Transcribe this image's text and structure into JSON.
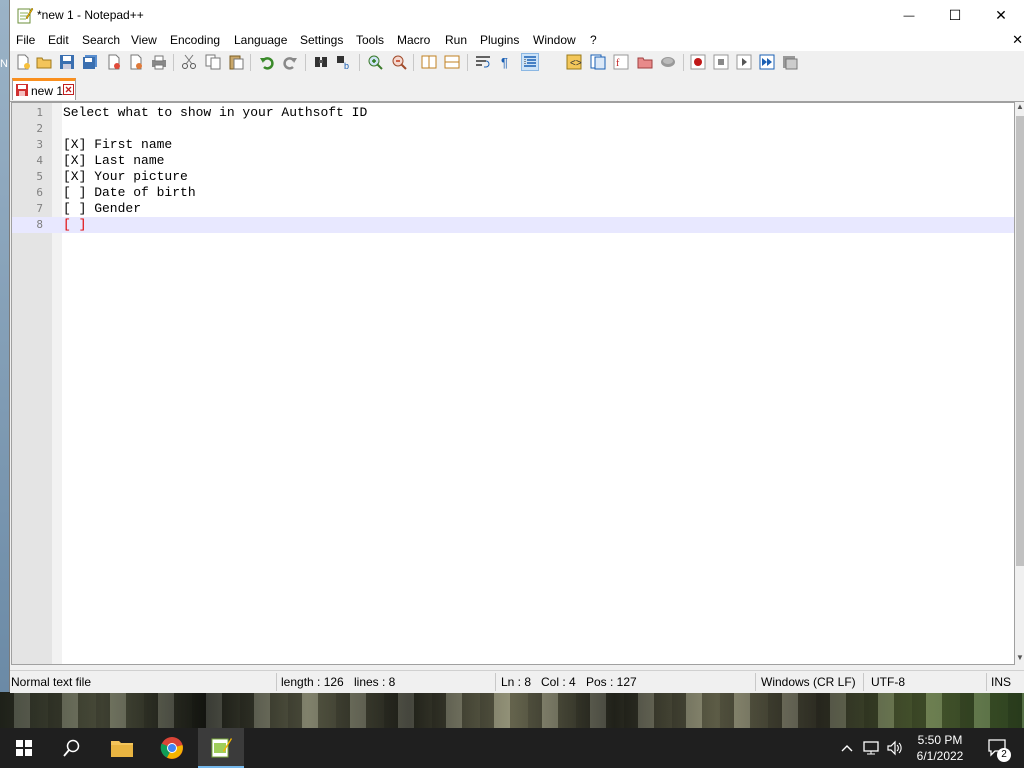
{
  "window": {
    "title": "*new 1 - Notepad++",
    "minimize_glyph": "—",
    "maximize_glyph": "☐",
    "close_glyph": "✕"
  },
  "menu": {
    "items": [
      "File",
      "Edit",
      "Search",
      "View",
      "Encoding",
      "Language",
      "Settings",
      "Tools",
      "Macro",
      "Run",
      "Plugins",
      "Window",
      "?"
    ],
    "close_glyph": "✕"
  },
  "toolbar": {
    "icons": [
      "new-file-icon",
      "open-file-icon",
      "save-icon",
      "save-all-icon",
      "close-icon",
      "close-all-icon",
      "print-icon",
      "cut-icon",
      "copy-icon",
      "paste-icon",
      "undo-icon",
      "redo-icon",
      "find-icon",
      "replace-icon",
      "zoom-in-icon",
      "zoom-out-icon",
      "sync-vertical-icon",
      "sync-horizontal-icon",
      "word-wrap-icon",
      "show-all-chars-icon",
      "indent-guide-icon",
      "udl-icon",
      "doc-map-icon",
      "function-list-icon",
      "folder-workspace-icon",
      "monitoring-icon",
      "record-macro-icon",
      "stop-record-icon",
      "play-macro-icon",
      "run-macro-multiple-icon",
      "save-macro-icon"
    ]
  },
  "tabs": [
    {
      "label": "new 1",
      "modified": true,
      "active": true
    }
  ],
  "editor": {
    "lines": [
      {
        "num": "1",
        "text": "Select what to show in your Authsoft ID"
      },
      {
        "num": "2",
        "text": ""
      },
      {
        "num": "3",
        "text": "[X] First name"
      },
      {
        "num": "4",
        "text": "[X] Last name"
      },
      {
        "num": "5",
        "text": "[X] Your picture"
      },
      {
        "num": "6",
        "text": "[ ] Date of birth"
      },
      {
        "num": "7",
        "text": "[ ] Gender"
      },
      {
        "num": "8",
        "text": "[ ]"
      }
    ],
    "current_line": "8"
  },
  "status": {
    "file_type": "Normal text file",
    "length": "length : 126",
    "lines": "lines : 8",
    "ln": "Ln : 8",
    "col": "Col : 4",
    "pos": "Pos : 127",
    "eol": "Windows (CR LF)",
    "encoding": "UTF-8",
    "mode": "INS"
  },
  "desktop": {
    "edge_letter": "N"
  },
  "taskbar": {
    "time": "5:50 PM",
    "date": "6/1/2022",
    "notification_count": "2",
    "colors": {
      "background": "#1f1f1f",
      "active_indicator": "#76b9ed"
    }
  }
}
